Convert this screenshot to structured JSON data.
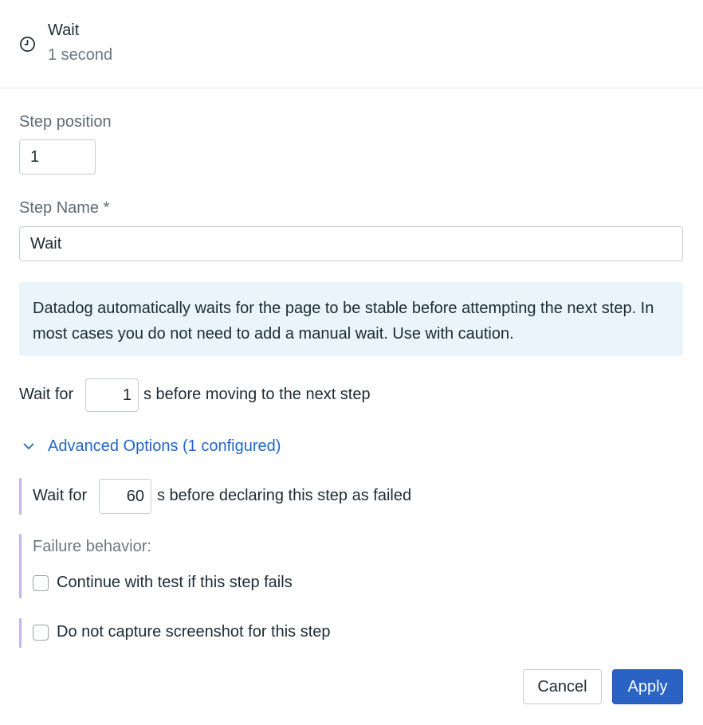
{
  "header": {
    "icon": "clock-icon",
    "title": "Wait",
    "subtitle": "1 second"
  },
  "step_position": {
    "label": "Step position",
    "value": "1"
  },
  "step_name": {
    "label": "Step Name *",
    "value": "Wait"
  },
  "info": {
    "text": "Datadog automatically waits for the page to be stable before attempting the next step. In most cases you do not need to add a manual wait. Use with caution."
  },
  "wait_row": {
    "prefix": "Wait for",
    "value": "1",
    "suffix": "s before moving to the next step"
  },
  "advanced": {
    "toggle_label": "Advanced Options (1 configured)",
    "icon": "chevron-down-icon",
    "timeout_row": {
      "prefix": "Wait for",
      "value": "60",
      "suffix": "s before declaring this step as failed"
    },
    "failure_behavior": {
      "label": "Failure behavior:",
      "checkbox_label": "Continue with test if this step fails",
      "checked": false
    },
    "screenshot": {
      "checkbox_label": "Do not capture screenshot for this step",
      "checked": false
    }
  },
  "footer": {
    "cancel_label": "Cancel",
    "apply_label": "Apply"
  },
  "colors": {
    "accent": "#2a63c4",
    "link": "#2367c7",
    "info_bg": "#eaf4fb",
    "advanced_bar": "#c8b3e6"
  }
}
